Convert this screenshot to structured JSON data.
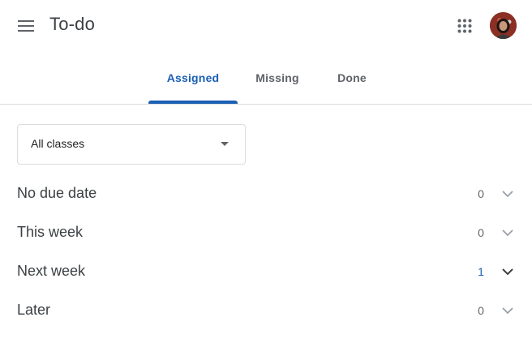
{
  "header": {
    "title": "To-do",
    "menu_icon": "hamburger-menu-icon",
    "apps_icon": "apps-grid-icon"
  },
  "tabs": [
    {
      "label": "Assigned",
      "active": true
    },
    {
      "label": "Missing",
      "active": false
    },
    {
      "label": "Done",
      "active": false
    }
  ],
  "filter": {
    "selected": "All classes"
  },
  "sections": [
    {
      "label": "No due date",
      "count": "0",
      "highlight": false
    },
    {
      "label": "This week",
      "count": "0",
      "highlight": false
    },
    {
      "label": "Next week",
      "count": "1",
      "highlight": true
    },
    {
      "label": "Later",
      "count": "0",
      "highlight": false
    }
  ],
  "colors": {
    "accent": "#1a5fb4",
    "text": "#3c4043",
    "muted": "#5f6368",
    "border": "#dadce0"
  }
}
